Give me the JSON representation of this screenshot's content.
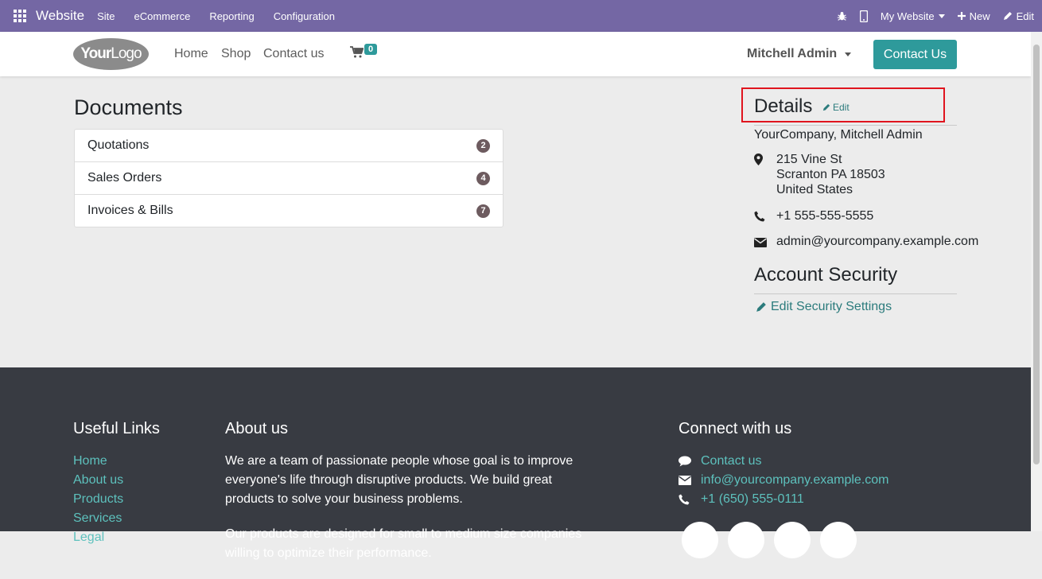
{
  "topbar": {
    "brand": "Website",
    "menu": [
      "Site",
      "eCommerce",
      "Reporting",
      "Configuration"
    ],
    "website_selector": "My Website",
    "new_label": "New",
    "edit_label": "Edit",
    "bg_color": "#7467a4"
  },
  "header": {
    "logo_text_bold": "Your",
    "logo_text": "Logo",
    "nav": [
      "Home",
      "Shop",
      "Contact us"
    ],
    "cart_count": "0",
    "user_name": "Mitchell Admin",
    "contact_button": "Contact Us",
    "accent_color": "#2e9a9b"
  },
  "documents": {
    "title": "Documents",
    "items": [
      {
        "label": "Quotations",
        "count": "2"
      },
      {
        "label": "Sales Orders",
        "count": "4"
      },
      {
        "label": "Invoices & Bills",
        "count": "7"
      }
    ]
  },
  "details": {
    "title": "Details",
    "edit_label": "Edit",
    "name": "YourCompany, Mitchell Admin",
    "address_line1": "215 Vine St",
    "address_line2": "Scranton PA 18503",
    "address_line3": "United States",
    "phone": "+1 555-555-5555",
    "email": "admin@yourcompany.example.com"
  },
  "security": {
    "title": "Account Security",
    "edit_label": "Edit Security Settings"
  },
  "footer": {
    "useful_links_title": "Useful Links",
    "useful_links": [
      "Home",
      "About us",
      "Products",
      "Services",
      "Legal"
    ],
    "about_title": "About us",
    "about_text": "We are a team of passionate people whose goal is to improve everyone's life through disruptive products. We build great products to solve your business problems.",
    "about_text2": "Our products are designed for small to medium size companies willing to optimize their performance.",
    "connect_title": "Connect with us",
    "contact_label": "Contact us",
    "email": "info@yourcompany.example.com",
    "phone": "+1 (650) 555-0111",
    "bg_color": "#383b42",
    "link_color": "#5dc1bd"
  }
}
